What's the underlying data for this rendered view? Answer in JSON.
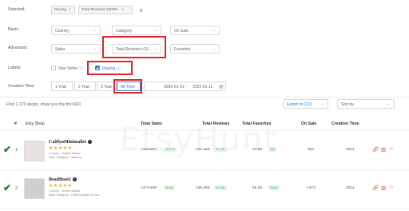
{
  "filters": {
    "selected_label": "Selected:",
    "selected_tags": [
      {
        "label": "Raving"
      },
      {
        "label": "Total Reviews:10000~"
      }
    ],
    "basic_label": "Basic:",
    "basic": [
      "Country",
      "Category",
      "On Sale"
    ],
    "advanced_label": "Advanced:",
    "advanced": [
      "Sales",
      "Total Reviews:>10...",
      "Favorites"
    ],
    "labels_label": "Labels:",
    "labels": [
      {
        "label": "Star Seller",
        "checked": false
      },
      {
        "label": "Raving",
        "checked": true
      }
    ],
    "creation_time_label": "Creation Time:",
    "time_ranges": [
      "1 Year",
      "2 Year",
      "3 Year",
      "All Time"
    ],
    "active_range": "All Time",
    "date_start": "2005-01-01",
    "date_sep": "~",
    "date_end": "2022-01-11"
  },
  "results": {
    "summary": "Find 1,170 shops, show you the first 600",
    "export_label": "Export to CSV",
    "sort_label": "Sort by"
  },
  "table": {
    "headers": [
      "#",
      "Etsy Shop",
      "Total Sales",
      "Total Reviews",
      "Total Favorites",
      "On Sale",
      "Creation Time"
    ],
    "rows": [
      {
        "rank": "1",
        "shop": "CaitlynMinimalist",
        "stars": "★★★★★",
        "country": "Country : United States",
        "category": "Main Category : Jewelry",
        "total_sales": "1463.52K",
        "sales_delta": "10.27K",
        "total_reviews": "241.46K",
        "reviews_delta": "11.17K",
        "total_favorites": "24.9K",
        "favorites_delta": "189",
        "on_sale": "952",
        "creation": "2014"
      },
      {
        "rank": "2",
        "shop": "BeadBoat1",
        "stars": "★★★★★",
        "country": "Country : United States",
        "category": "Main Category : Craft Supplies & Tool...",
        "total_sales": "1374.83K",
        "sales_delta": "39.6K",
        "total_reviews": "138.28K",
        "reviews_delta": "11.15K",
        "total_favorites": "55.2K",
        "favorites_delta": "28.6K",
        "on_sale": "7,672",
        "creation": "2014"
      }
    ]
  },
  "watermark": "EtsyHunt",
  "colors": {
    "accent": "#2d7de0",
    "highlight": "#e0242a",
    "positive": "#38a34b"
  }
}
